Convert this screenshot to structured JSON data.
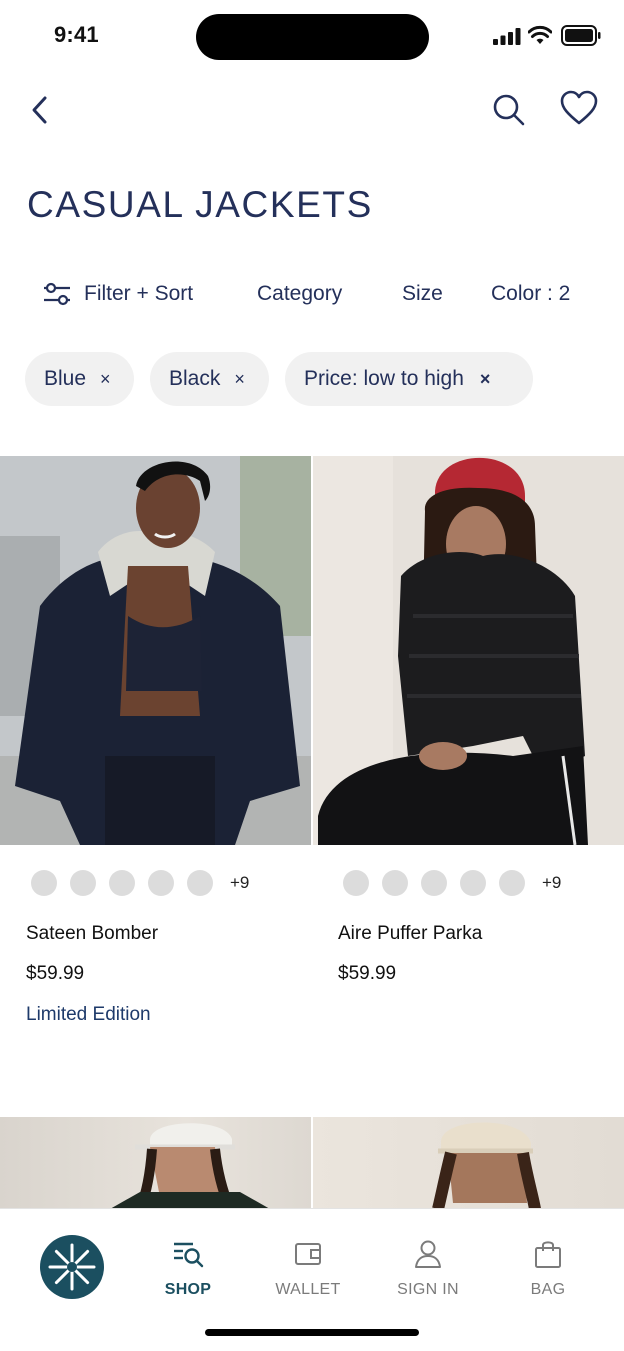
{
  "status_bar": {
    "time": "9:41"
  },
  "header": {
    "title": "CASUAL JACKETS"
  },
  "filters": {
    "filter_sort": "Filter + Sort",
    "category": "Category",
    "size": "Size",
    "color": "Color : 2"
  },
  "chips": [
    {
      "label": "Blue",
      "remove": "×"
    },
    {
      "label": "Black",
      "remove": "×"
    },
    {
      "label": "Price: low to high",
      "remove": "×"
    }
  ],
  "products": [
    {
      "name": "Sateen Bomber",
      "price": "$59.99",
      "badge": "Limited Edition",
      "more_colors": "+9"
    },
    {
      "name": "Aire Puffer Parka",
      "price": "$59.99",
      "badge": "",
      "more_colors": "+9"
    }
  ],
  "tabbar": {
    "shop": "SHOP",
    "wallet": "WALLET",
    "sign_in": "SIGN IN",
    "bag": "BAG"
  },
  "colors": {
    "navy": "#24305a",
    "teal": "#1b4f60",
    "chip_bg": "#f1f1f1"
  }
}
